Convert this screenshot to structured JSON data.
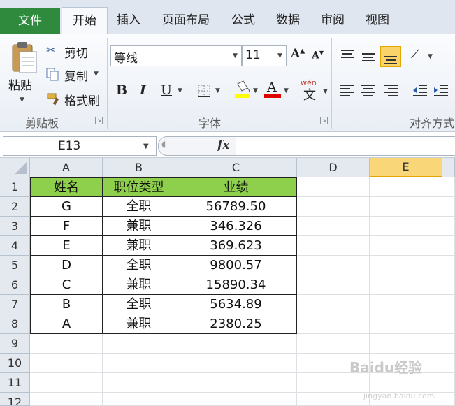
{
  "tabs": [
    "文件",
    "开始",
    "插入",
    "页面布局",
    "公式",
    "数据",
    "审阅",
    "视图"
  ],
  "clipboard": {
    "paste": "粘贴",
    "cut": "剪切",
    "copy": "复制",
    "format_painter": "格式刷",
    "group_label": "剪贴板"
  },
  "font": {
    "name": "等线",
    "size": "11",
    "bold": "B",
    "italic": "I",
    "underline": "U",
    "font_color_glyph": "A",
    "phonetic": "wén",
    "phonetic_char": "文",
    "group_label": "字体"
  },
  "alignment": {
    "group_label": "对齐方式"
  },
  "formula_bar": {
    "name_box": "E13",
    "fx": "fx",
    "formula": ""
  },
  "columns": [
    "A",
    "B",
    "C",
    "D",
    "E"
  ],
  "rows": [
    "1",
    "2",
    "3",
    "4",
    "5",
    "6",
    "7",
    "8",
    "9",
    "10",
    "11",
    "12"
  ],
  "selected_column": "E",
  "table": {
    "headers": [
      "姓名",
      "职位类型",
      "业绩"
    ],
    "rows": [
      [
        "G",
        "全职",
        "56789.50"
      ],
      [
        "F",
        "兼职",
        "346.326"
      ],
      [
        "E",
        "兼职",
        "369.623"
      ],
      [
        "D",
        "全职",
        "9800.57"
      ],
      [
        "C",
        "兼职",
        "15890.34"
      ],
      [
        "B",
        "全职",
        "5634.89"
      ],
      [
        "A",
        "兼职",
        "2380.25"
      ]
    ]
  },
  "colors": {
    "file_tab": "#2f8a3e",
    "header_fill": "#8ecf4c",
    "selected_header": "#f9d778",
    "font_color": "#e00000",
    "highlight": "#ffff00"
  },
  "watermark": {
    "main": "Baidu经验",
    "sub": "jingyan.baidu.com"
  }
}
